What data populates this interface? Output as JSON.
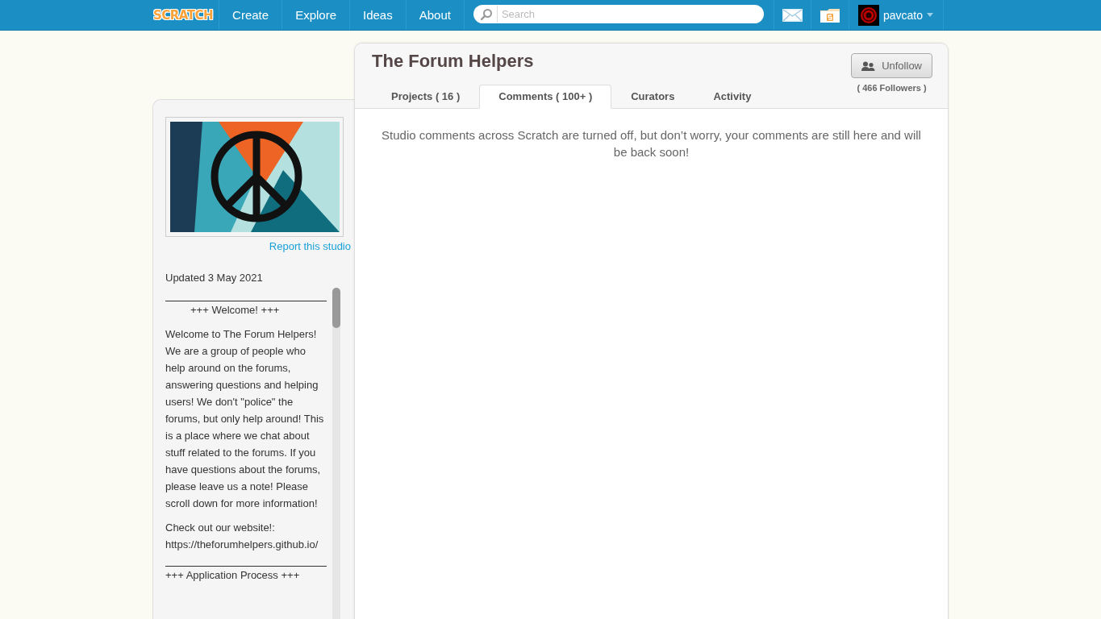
{
  "nav": {
    "logo": "SCRATCH",
    "links": [
      "Create",
      "Explore",
      "Ideas",
      "About"
    ],
    "search": {
      "placeholder": "Search"
    },
    "user": "pavcato"
  },
  "sidebar": {
    "report_link": "Report this studio",
    "updated": "Updated 3 May 2021",
    "description": [
      {
        "kind": "rule"
      },
      {
        "kind": "heading",
        "text": "+++ Welcome! +++",
        "centered": true
      },
      {
        "kind": "paragraph",
        "text": "Welcome to The Forum Helpers! We are a group of people who help around on the forums, answering questions and helping users! We don't \"police\" the forums, but only help around! This is a place where we chat about stuff related to the forums. If you have questions about the forums, please leave us a note! Please scroll down for more information!"
      },
      {
        "kind": "paragraph",
        "text": "Check out our website!:\nhttps://theforumhelpers.github.io/"
      },
      {
        "kind": "rule"
      },
      {
        "kind": "heading",
        "text": "+++ Application Process +++",
        "centered": false
      }
    ]
  },
  "studio": {
    "title": "The Forum Helpers",
    "follow_button": "Unfollow",
    "followers": "( 466 Followers )",
    "tabs": [
      {
        "label": "Projects ( 16 )",
        "selected": false
      },
      {
        "label": "Comments ( 100+ )",
        "selected": true
      },
      {
        "label": "Curators",
        "selected": false
      },
      {
        "label": "Activity",
        "selected": false
      }
    ],
    "notice": "Studio comments across Scratch are turned off, but don’t worry, your comments are still here and will be back soon!"
  }
}
